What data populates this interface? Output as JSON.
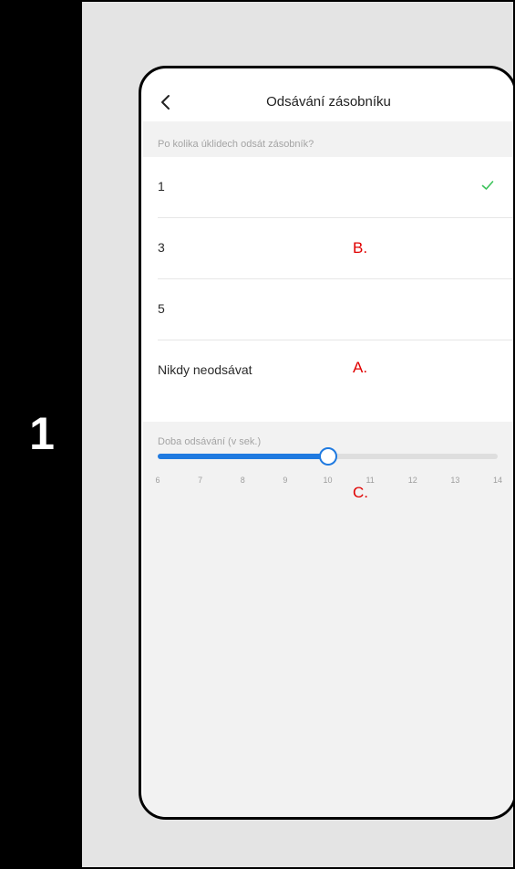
{
  "step": {
    "number": "1"
  },
  "header": {
    "title": "Odsávání zásobníku"
  },
  "icons": {
    "back": "chevron-left-icon",
    "check": "check-icon"
  },
  "frequency": {
    "label": "Po kolika úklidech odsát zásobník?",
    "options": [
      {
        "label": "1",
        "selected": true
      },
      {
        "label": "3",
        "selected": false
      },
      {
        "label": "5",
        "selected": false
      },
      {
        "label": "Nikdy neodsávat",
        "selected": false
      }
    ]
  },
  "duration": {
    "label": "Doba odsávání (v sek.)",
    "ticks": [
      "6",
      "7",
      "8",
      "9",
      "10",
      "11",
      "12",
      "13",
      "14"
    ],
    "min": 6,
    "max": 14,
    "value": 10
  },
  "annotations": {
    "a": "A.",
    "b": "B.",
    "c": "C."
  },
  "colors": {
    "accent": "#1f7ae0",
    "check": "#3cc35a",
    "annotation": "#e00000",
    "sidebar": "#000000"
  }
}
